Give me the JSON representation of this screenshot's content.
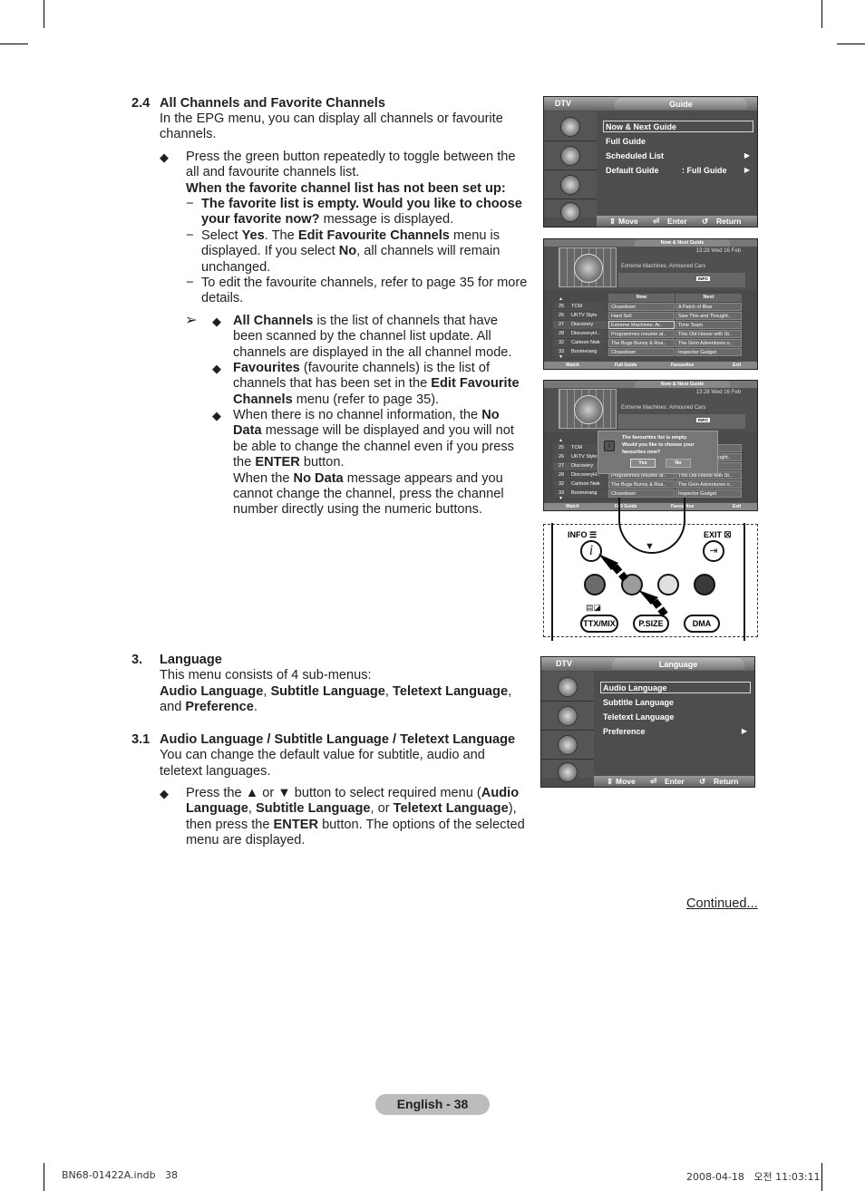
{
  "section_2_4": {
    "number": "2.4",
    "title": "All Channels and Favorite Channels",
    "intro_l1": "In the EPG menu, you can display all channels or favourite",
    "intro_l2": "channels.",
    "bullet1": {
      "l1": "Press the green button repeatedly to toggle between the",
      "l2": "all and favourite channels list.",
      "subhead": "When the favorite channel list has not been set up:",
      "dash1_bold_l1": "The favorite list is empty. Would you like to choose",
      "dash1_bold_l2": "your favorite now?",
      "dash1_rest": " message is displayed.",
      "dash2_a": "Select ",
      "dash2_yes": "Yes",
      "dash2_b": ". The ",
      "dash2_edit": "Edit Favourite Channels",
      "dash2_c": " menu is",
      "dash2_l2a": "displayed. If you select ",
      "dash2_no": "No",
      "dash2_l2b": ", all channels will remain",
      "dash2_l3": "unchanged.",
      "dash3_l1": "To edit the favourite channels, refer to page 35 for more",
      "dash3_l2": "details."
    },
    "notes": {
      "n1_bold": "All Channels",
      "n1_l1": " is the list of channels that have",
      "n1_l2": "been scanned by the channel list update. All",
      "n1_l3": "channels are displayed in the all channel mode.",
      "n2_bold": "Favourites",
      "n2_l1": " (favourite channels) is the list of",
      "n2_l2a": "channels that has been set in the ",
      "n2_l2b": "Edit Favourite",
      "n2_l3a": "Channels",
      "n2_l3b": " menu (refer to page 35).",
      "n3_l1a": "When there is no channel information, the ",
      "n3_l1b": "No",
      "n3_l2a": "Data",
      "n3_l2b": " message will be displayed and you will not",
      "n3_l3": "be able to change the channel even if you press",
      "n3_l4a": "the ",
      "n3_l4b": "ENTER",
      "n3_l4c": " button.",
      "n3_l5a": "When the ",
      "n3_l5b": "No Data",
      "n3_l5c": " message appears and you",
      "n3_l6": "cannot change the channel, press the channel",
      "n3_l7": "number directly using the numeric buttons."
    }
  },
  "section_3": {
    "number": "3.",
    "title": "Language",
    "intro": "This menu consists of 4 sub-menus:",
    "m1": "Audio Language",
    "m2": "Subtitle Language",
    "m3": "Teletext Language",
    "and": "and ",
    "m4": "Preference"
  },
  "section_3_1": {
    "number": "3.1",
    "title": "Audio Language / Subtitle Language / Teletext Language",
    "l1": "You can change the default value for subtitle, audio and",
    "l2": "teletext languages.",
    "b_l1a": "Press the ▲ or ▼ button to select required menu (",
    "b_l1b": "Audio",
    "b_l2a": "Language",
    "b_l2b": ", ",
    "b_l2c": "Subtitle Language",
    "b_l2d": ", or ",
    "b_l2e": "Teletext Language",
    "b_l2f": "),",
    "b_l3a": "then press the ",
    "b_l3b": "ENTER",
    "b_l3c": " button. The options of the selected",
    "b_l4": "menu are displayed."
  },
  "guide_screen": {
    "mode": "DTV",
    "title": "Guide",
    "items": [
      {
        "label": "Now & Next Guide",
        "value": "",
        "arrow": false,
        "selected": true
      },
      {
        "label": "Full Guide",
        "value": "",
        "arrow": false
      },
      {
        "label": "Scheduled List",
        "value": "",
        "arrow": true
      },
      {
        "label": "Default Guide",
        "value": ": Full Guide",
        "arrow": true
      }
    ],
    "footer": {
      "move": "Move",
      "enter": "Enter",
      "return": "Return"
    }
  },
  "epg": {
    "title": "Now & Next Guide",
    "datetime": "13:28 Wed 16 Feb",
    "program": "Extreme Machines: Armoured Cars",
    "info": "INFO",
    "col_now": "Now",
    "col_next": "Next",
    "rows": [
      {
        "num": "25",
        "name": "TCM",
        "now": "Closedown",
        "next": "A Patch of Blue"
      },
      {
        "num": "26",
        "name": "UKTV Style",
        "now": "Hard Sell",
        "next": "Saw This and Thought.."
      },
      {
        "num": "27",
        "name": "Discovery",
        "now": "Extreme Machines: Ar..",
        "next": "Time Team"
      },
      {
        "num": "28",
        "name": "DiscoveryH..",
        "now": "Programmes resume at..",
        "next": "This Old House with St.."
      },
      {
        "num": "32",
        "name": "Cartoon Nwk",
        "now": "The Bugs Bunny & Roa..",
        "next": "The Grim Adventures o.."
      },
      {
        "num": "33",
        "name": "Boomerang",
        "now": "Closedown",
        "next": "Inspector Gadget"
      }
    ],
    "footer": {
      "watch": "Watch",
      "full_guide": "Full Guide",
      "favourites": "Favourites",
      "exit": "Exit"
    },
    "dialog": {
      "l1": "The favourites list is empty.",
      "l2": "Would you like to choose your",
      "l3": "favourites now?",
      "yes": "Yes",
      "no": "No"
    }
  },
  "remote": {
    "info": "INFO",
    "exit": "EXIT",
    "ttx": "TTX/MIX",
    "psize": "P.SIZE",
    "dma": "DMA",
    "colors": {
      "red": "#6b6b6b",
      "green": "#9c9c9c",
      "yellow": "#e0e0e0",
      "blue": "#3a3a3a"
    }
  },
  "language_screen": {
    "mode": "DTV",
    "title": "Language",
    "items": [
      {
        "label": "Audio Language",
        "arrow": false,
        "selected": true
      },
      {
        "label": "Subtitle Language",
        "arrow": false
      },
      {
        "label": "Teletext Language",
        "arrow": false
      },
      {
        "label": "Preference",
        "arrow": true
      }
    ],
    "footer": {
      "move": "Move",
      "enter": "Enter",
      "return": "Return"
    }
  },
  "continued": "Continued...",
  "page_label": "English - 38",
  "print_footer": {
    "file": "BN68-01422A.indb   38",
    "date": "2008-04-18   오전 11:03:11"
  }
}
